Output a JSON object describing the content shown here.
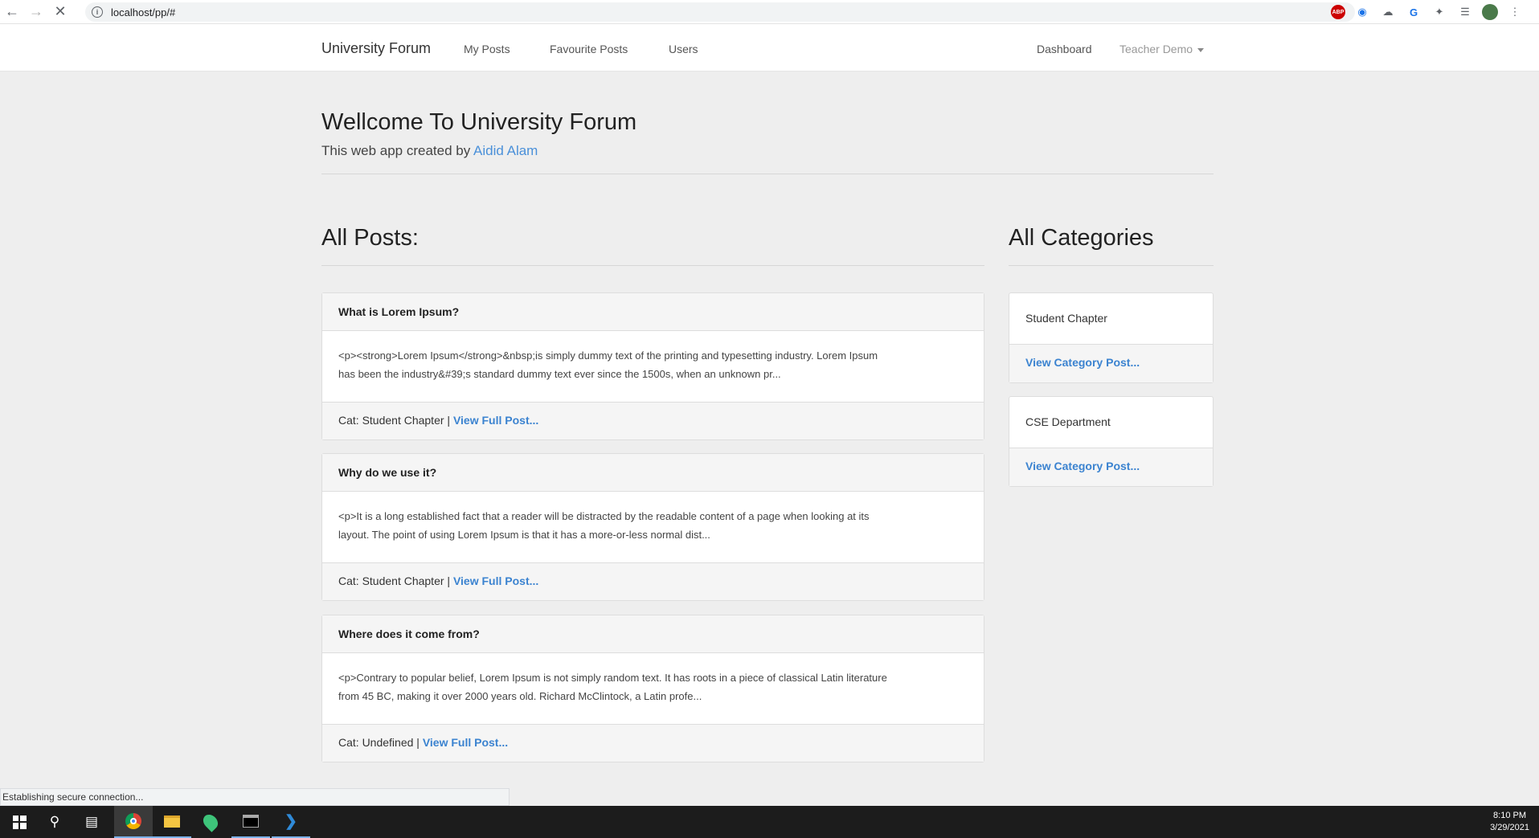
{
  "browser": {
    "url": "localhost/pp/#",
    "status_text": "Establishing secure connection..."
  },
  "navbar": {
    "brand": "University Forum",
    "links": [
      "My Posts",
      "Favourite Posts",
      "Users"
    ],
    "dashboard": "Dashboard",
    "user_menu": "Teacher Demo"
  },
  "jumbotron": {
    "title": "Wellcome To University Forum",
    "subtitle_prefix": "This web app created by",
    "author": "Aidid Alam"
  },
  "posts_section": {
    "title": "All Posts:",
    "posts": [
      {
        "title": "What is Lorem Ipsum?",
        "excerpt_line1": "<p><strong>Lorem Ipsum</strong>&nbsp;is simply dummy text of the printing and typesetting industry. Lorem Ipsum",
        "excerpt_line2": "has been the industry&#39;s standard dummy text ever since the 1500s, when an unknown pr...",
        "category": "Cat: Student Chapter |",
        "link": "View Full Post..."
      },
      {
        "title": "Why do we use it?",
        "excerpt_line1": "<p>It is a long established fact that a reader will be distracted by the readable content of a page when looking at its",
        "excerpt_line2": "layout. The point of using Lorem Ipsum is that it has a more-or-less normal dist...",
        "category": "Cat: Student Chapter |",
        "link": "View Full Post..."
      },
      {
        "title": "Where does it come from?",
        "excerpt_line1": "<p>Contrary to popular belief, Lorem Ipsum is not simply random text. It has roots in a piece of classical Latin literature",
        "excerpt_line2": "from 45 BC, making it over 2000 years old. Richard McClintock, a Latin profe...",
        "category": "Cat: Undefined |",
        "link": "View Full Post..."
      }
    ]
  },
  "categories_section": {
    "title": "All Categories",
    "categories": [
      {
        "name": "Student Chapter",
        "link": "View Category Post..."
      },
      {
        "name": "CSE Department",
        "link": "View Category Post..."
      }
    ]
  },
  "taskbar": {
    "time": "8:10 PM",
    "date": "3/29/2021"
  },
  "icons": [
    "back-icon",
    "forward-icon",
    "reload-icon",
    "info-icon",
    "star-icon",
    "adblock-icon",
    "camera-icon",
    "cloud-icon",
    "translate-icon",
    "extensions-icon",
    "playlist-icon",
    "profile-icon",
    "more-icon",
    "windows-start-icon",
    "search-icon",
    "task-view-icon",
    "chrome-icon",
    "folder-icon",
    "maps-icon",
    "terminal-icon",
    "vscode-icon"
  ],
  "colors": {
    "accent_link": "#3b83d0",
    "author_link": "#4a90d9",
    "taskbar": "#1c1c1c"
  }
}
